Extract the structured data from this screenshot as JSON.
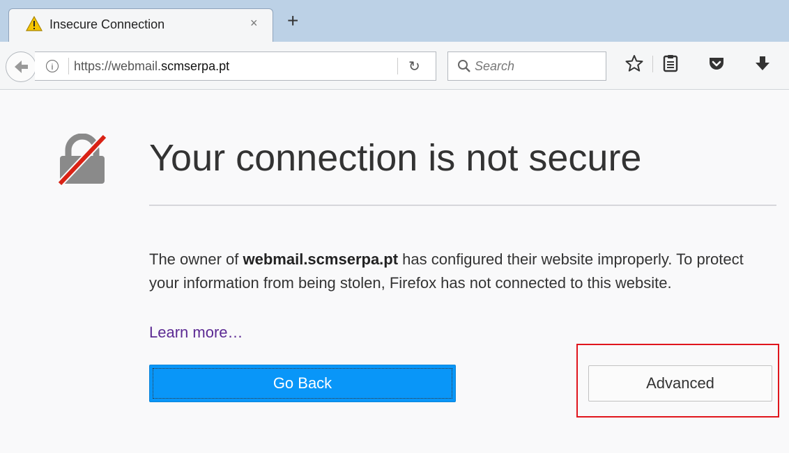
{
  "tab": {
    "title": "Insecure Connection",
    "close_glyph": "×",
    "new_tab_glyph": "+",
    "warning_icon": "warning-icon"
  },
  "navbar": {
    "info_glyph": "i",
    "url_prefix": "https://webmail.",
    "url_domain": "scmserpa.pt",
    "reload_glyph": "↻",
    "search_placeholder": "Search",
    "icons": [
      "bookmark-star-icon",
      "reading-list-icon",
      "pocket-icon",
      "download-icon"
    ]
  },
  "page": {
    "title": "Your connection is not secure",
    "desc_prefix": "The owner of ",
    "desc_host": "webmail.scmserpa.pt",
    "desc_suffix": " has configured their website improperly. To protect your information from being stolen, Firefox has not connected to this website.",
    "learn_more": "Learn more…",
    "go_back_label": "Go Back",
    "advanced_label": "Advanced"
  },
  "colors": {
    "primary_button": "#0996f8",
    "highlight_box": "#e0151c",
    "link": "#5c2a93"
  }
}
